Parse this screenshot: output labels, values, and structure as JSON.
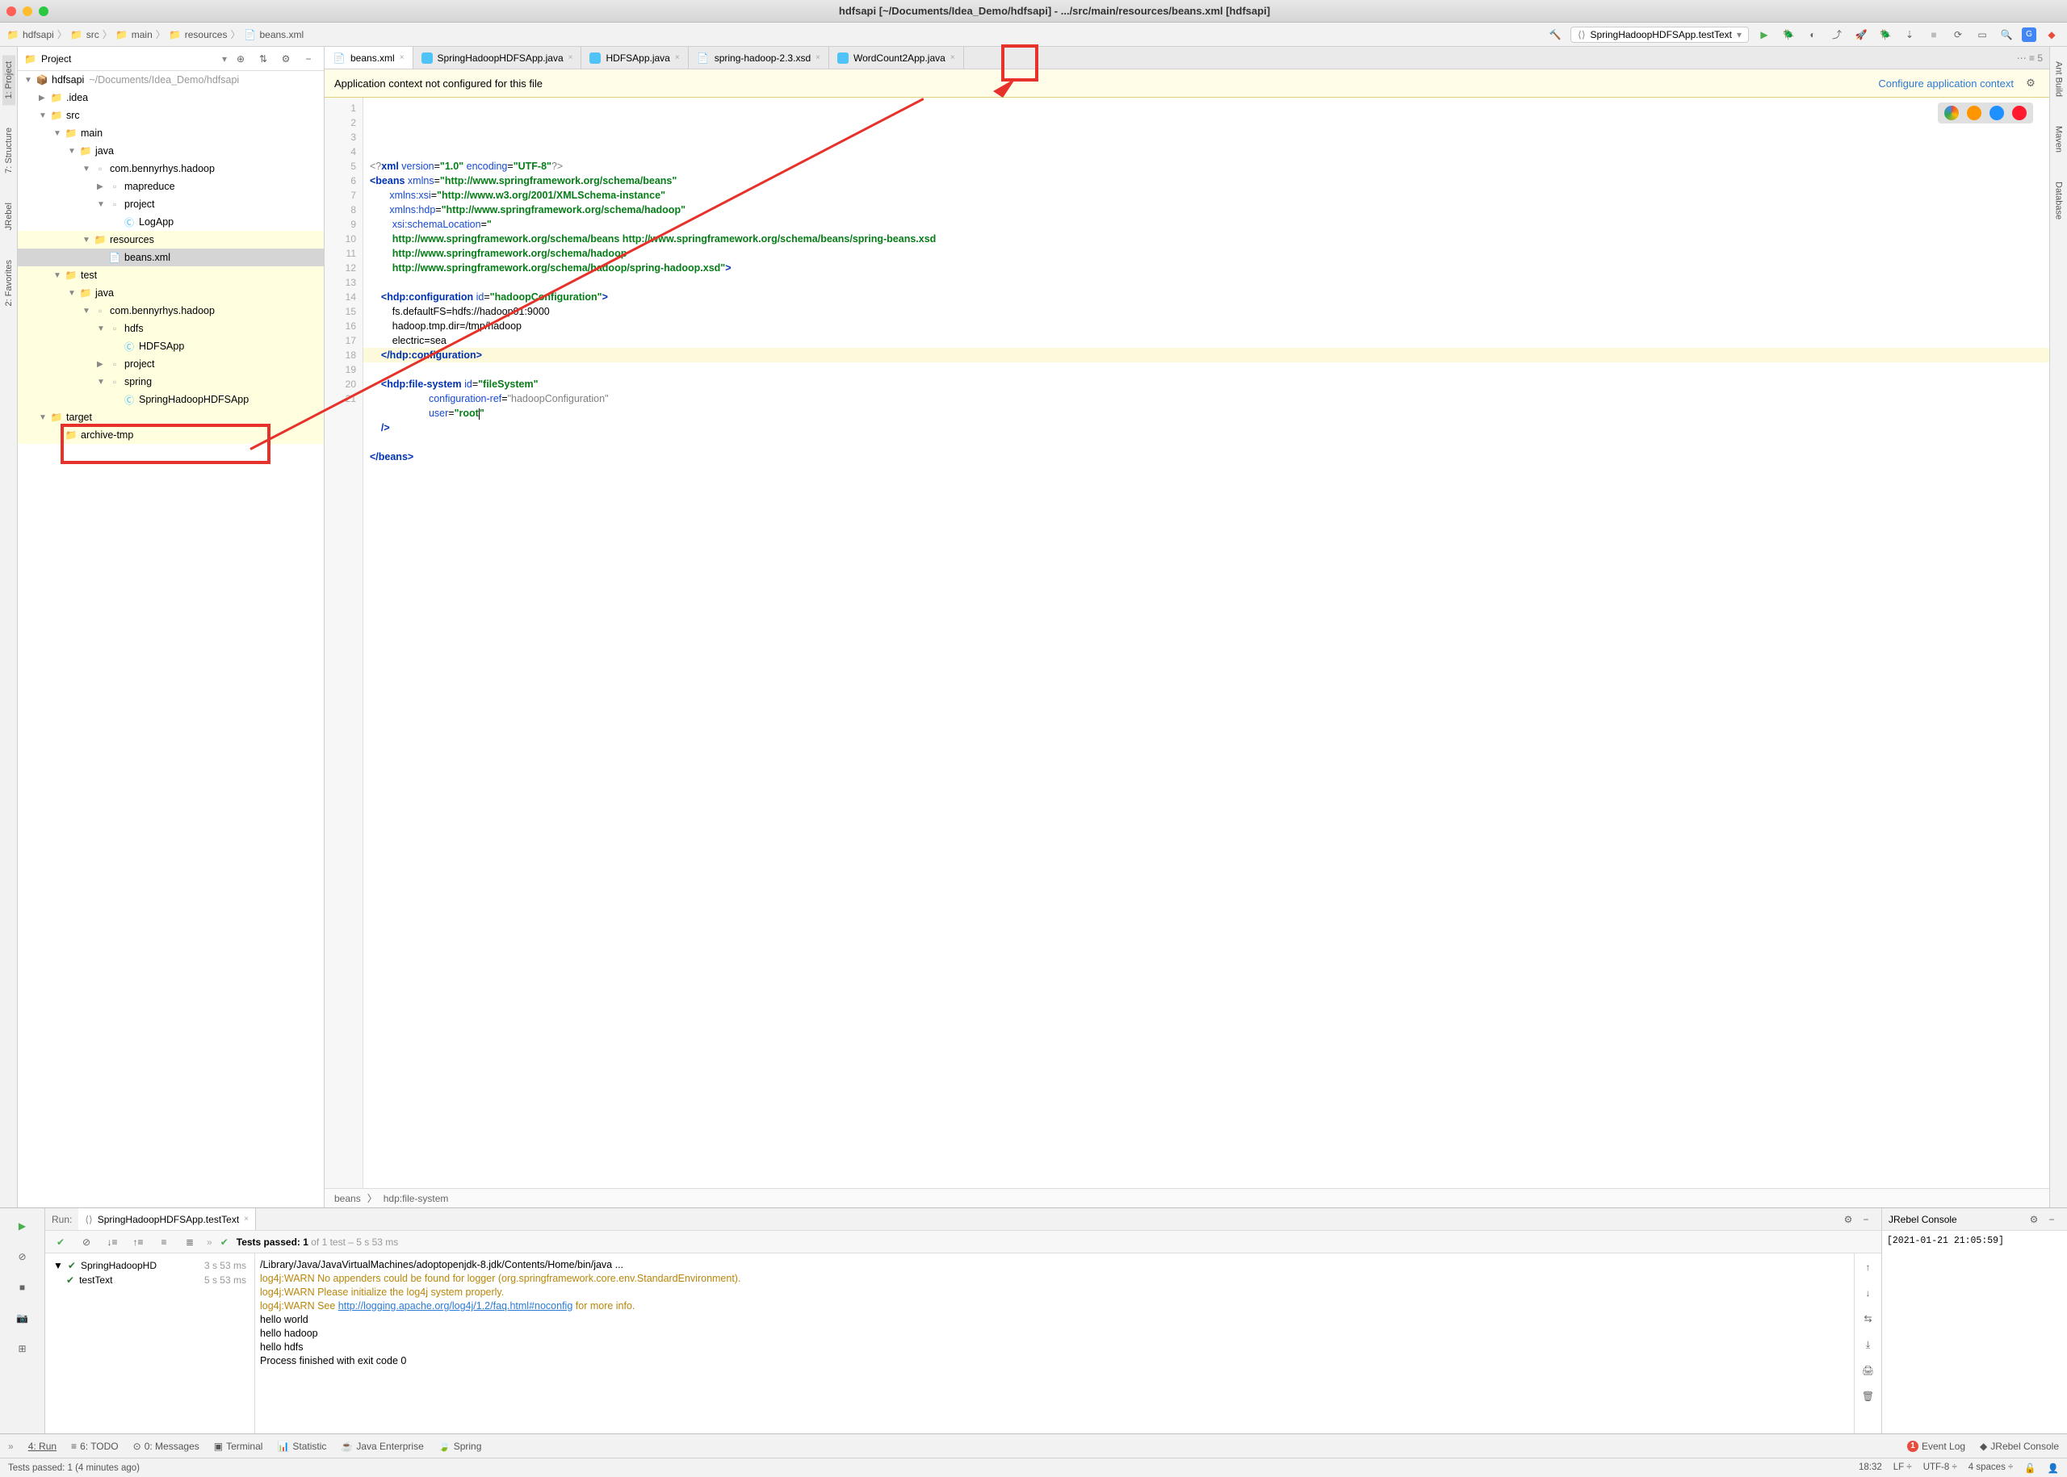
{
  "window_title": "hdfsapi [~/Documents/Idea_Demo/hdfsapi] - .../src/main/resources/beans.xml [hdfsapi]",
  "breadcrumbs": [
    "hdfsapi",
    "src",
    "main",
    "resources",
    "beans.xml"
  ],
  "run_config": "SpringHadoopHDFSApp.testText",
  "project_panel": {
    "title": "Project"
  },
  "tree": [
    {
      "depth": 0,
      "arrow": "▼",
      "icon": "module",
      "label": "hdfsapi",
      "path": "~/Documents/Idea_Demo/hdfsapi",
      "hl": false
    },
    {
      "depth": 1,
      "arrow": "▶",
      "icon": "folder",
      "label": ".idea",
      "hl": false
    },
    {
      "depth": 1,
      "arrow": "▼",
      "icon": "folder",
      "label": "src",
      "hl": false
    },
    {
      "depth": 2,
      "arrow": "▼",
      "icon": "folder",
      "label": "main",
      "hl": false
    },
    {
      "depth": 3,
      "arrow": "▼",
      "icon": "folder-src",
      "label": "java",
      "hl": false
    },
    {
      "depth": 4,
      "arrow": "▼",
      "icon": "package",
      "label": "com.bennyrhys.hadoop",
      "hl": false
    },
    {
      "depth": 5,
      "arrow": "▶",
      "icon": "package",
      "label": "mapreduce",
      "hl": false
    },
    {
      "depth": 5,
      "arrow": "▼",
      "icon": "package",
      "label": "project",
      "hl": false
    },
    {
      "depth": 6,
      "arrow": "",
      "icon": "java",
      "label": "LogApp",
      "hl": false
    },
    {
      "depth": 4,
      "arrow": "▼",
      "icon": "folder-res",
      "label": "resources",
      "hl": true,
      "boxed": true
    },
    {
      "depth": 5,
      "arrow": "",
      "icon": "xml",
      "label": "beans.xml",
      "hl": false,
      "selected": true,
      "boxed": true
    },
    {
      "depth": 2,
      "arrow": "▼",
      "icon": "folder",
      "label": "test",
      "hl": true
    },
    {
      "depth": 3,
      "arrow": "▼",
      "icon": "folder-test",
      "label": "java",
      "hl": true
    },
    {
      "depth": 4,
      "arrow": "▼",
      "icon": "package",
      "label": "com.bennyrhys.hadoop",
      "hl": true
    },
    {
      "depth": 5,
      "arrow": "▼",
      "icon": "package",
      "label": "hdfs",
      "hl": true
    },
    {
      "depth": 6,
      "arrow": "",
      "icon": "java",
      "label": "HDFSApp",
      "hl": true
    },
    {
      "depth": 5,
      "arrow": "▶",
      "icon": "package",
      "label": "project",
      "hl": true
    },
    {
      "depth": 5,
      "arrow": "▼",
      "icon": "package",
      "label": "spring",
      "hl": true
    },
    {
      "depth": 6,
      "arrow": "",
      "icon": "java",
      "label": "SpringHadoopHDFSApp",
      "hl": true
    },
    {
      "depth": 1,
      "arrow": "▼",
      "icon": "folder-excl",
      "label": "target",
      "hl": true
    },
    {
      "depth": 2,
      "arrow": "",
      "icon": "folder-excl",
      "label": "archive-tmp",
      "hl": true
    }
  ],
  "editor_tabs": [
    {
      "icon": "xml",
      "label": "beans.xml",
      "active": true
    },
    {
      "icon": "java",
      "label": "SpringHadoopHDFSApp.java",
      "active": false
    },
    {
      "icon": "java",
      "label": "HDFSApp.java",
      "active": false
    },
    {
      "icon": "xsd",
      "label": "spring-hadoop-2.3.xsd",
      "active": false
    },
    {
      "icon": "java",
      "label": "WordCount2App.java",
      "active": false
    }
  ],
  "notification": {
    "text": "Application context not configured for this file",
    "link": "Configure application context"
  },
  "line_numbers": [
    "1",
    "2",
    "3",
    "4",
    "5",
    "6",
    "7",
    "8",
    "9",
    "10",
    "11",
    "12",
    "13",
    "14",
    "15",
    "16",
    "17",
    "18",
    "19",
    "20",
    "21"
  ],
  "code_lines": {
    "l1": "<?xml version=\"1.0\" encoding=\"UTF-8\"?>",
    "l2a": "<beans",
    "l2b": "xmlns",
    "l2c": "\"http://www.springframework.org/schema/beans\"",
    "l3a": "xmlns:xsi",
    "l3b": "\"http://www.w3.org/2001/XMLSchema-instance\"",
    "l4a": "xmlns:hdp",
    "l4b": "\"http://www.springframework.org/schema/hadoop\"",
    "l5a": "xsi:schemaLocation",
    "l5b": "\"",
    "l6": "http://www.springframework.org/schema/beans http://www.springframework.org/schema/beans/spring-beans.xsd",
    "l7": "http://www.springframework.org/schema/hadoop",
    "l8": "http://www.springframework.org/schema/hadoop/spring-hadoop.xsd\"",
    "l10a": "<hdp:configuration",
    "l10b": "id",
    "l10c": "\"hadoopConfiguration\"",
    "l11": "fs.defaultFS=hdfs://hadoop01:9000",
    "l12": "hadoop.tmp.dir=/tmp/hadoop",
    "l13": "electric=sea",
    "l14": "</hdp:configuration>",
    "l16a": "<hdp:file-system",
    "l16b": "id",
    "l16c": "\"fileSystem\"",
    "l17a": "configuration-ref",
    "l17b": "\"hadoopConfiguration\"",
    "l18a": "user",
    "l18b": "\"root\"",
    "l19": "/>",
    "l21": "</beans>"
  },
  "editor_breadcrumb": [
    "beans",
    "hdp:file-system"
  ],
  "run_panel": {
    "label": "Run:",
    "tab": "SpringHadoopHDFSApp.testText",
    "tests_passed_text": "Tests passed: 1 of 1 test – 5 s 53 ms",
    "tests_prefix": "Tests passed: 1",
    "tests_suffix": " of 1 test – 5 s 53 ms",
    "tree": [
      {
        "label": "SpringHadoopHD",
        "time": "3 s 53 ms"
      },
      {
        "label": "testText",
        "time": "5 s 53 ms"
      }
    ],
    "console_lines": [
      {
        "text": "/Library/Java/JavaVirtualMachines/adoptopenjdk-8.jdk/Contents/Home/bin/java ...",
        "cls": ""
      },
      {
        "text": "log4j:WARN No appenders could be found for logger (org.springframework.core.env.StandardEnvironment).",
        "cls": "warn"
      },
      {
        "text": "log4j:WARN Please initialize the log4j system properly.",
        "cls": "warn"
      },
      {
        "prefix": "log4j:WARN See ",
        "link": "http://logging.apache.org/log4j/1.2/faq.html#noconfig",
        "suffix": " for more info.",
        "cls": "warn"
      },
      {
        "text": "hello world",
        "cls": ""
      },
      {
        "text": "hello hadoop",
        "cls": ""
      },
      {
        "text": "hello hdfs",
        "cls": ""
      },
      {
        "text": "",
        "cls": ""
      },
      {
        "text": "Process finished with exit code 0",
        "cls": ""
      }
    ]
  },
  "jrebel": {
    "title": "JRebel Console",
    "timestamp": "[2021-01-21 21:05:59]"
  },
  "tools": [
    "4: Run",
    "6: TODO",
    "0: Messages",
    "Terminal",
    "Statistic",
    "Java Enterprise",
    "Spring"
  ],
  "tools_right": [
    "Event Log",
    "JRebel Console"
  ],
  "status_left": "Tests passed: 1 (4 minutes ago)",
  "status_right": [
    "18:32",
    "LF ÷",
    "UTF-8 ÷",
    "4 spaces ÷"
  ],
  "left_tabs": [
    "1: Project",
    "7: Structure",
    "JRebel",
    "2: Favorites"
  ],
  "right_tabs": [
    "Ant Build",
    "Maven",
    "Database"
  ]
}
